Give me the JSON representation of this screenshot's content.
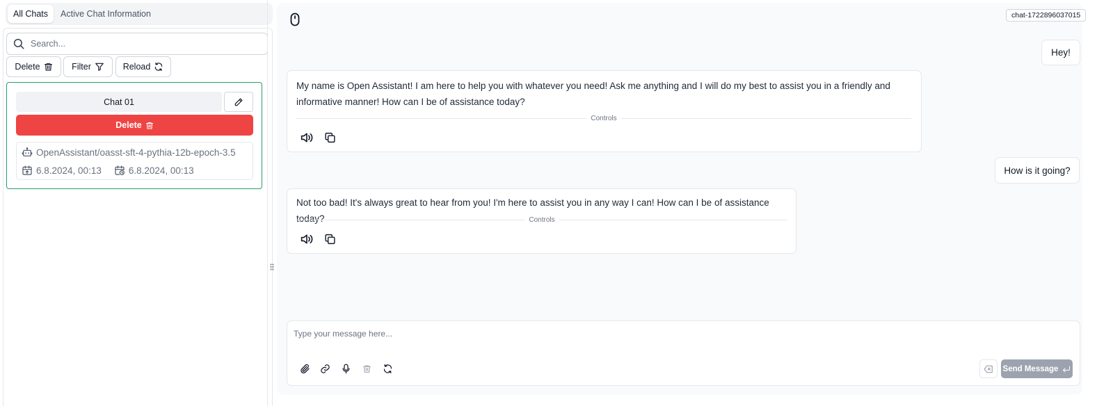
{
  "tabs": [
    {
      "label": "All Chats",
      "active": true
    },
    {
      "label": "Active Chat Information",
      "active": false
    }
  ],
  "search": {
    "placeholder": "Search..."
  },
  "toolbar": {
    "delete_label": "Delete",
    "filter_label": "Filter",
    "reload_label": "Reload"
  },
  "chat_list": [
    {
      "name": "Chat 01",
      "delete_label": "Delete",
      "model": "OpenAssistant/oasst-sft-4-pythia-12b-epoch-3.5",
      "created": "6.8.2024, 00:13",
      "updated": "6.8.2024, 00:13",
      "selected": true
    }
  ],
  "chat": {
    "id": "chat-1722896037015",
    "messages": [
      {
        "role": "user",
        "text": "Hey!"
      },
      {
        "role": "assistant",
        "lines": [
          "My name is Open Assistant! I am here to help you with whatever you need! Ask me anything and I will do my best to assist you in a friendly and",
          "informative manner! How can I be of assistance today?"
        ],
        "controls_label": "Controls"
      },
      {
        "role": "user",
        "text": "How is it going?"
      },
      {
        "role": "assistant",
        "lines": [
          "Not too bad! It's always great to hear from you! I'm here to assist you in any way I can! How can I be of assistance today?"
        ],
        "controls_label": "Controls"
      }
    ]
  },
  "composer": {
    "placeholder": "Type your message here...",
    "send_label": "Send Message",
    "icons": [
      "paperclip-icon",
      "link-icon",
      "microphone-icon",
      "trash-icon",
      "refresh-icon"
    ]
  },
  "colors": {
    "accent_green": "#22a06b",
    "danger": "#ef4444",
    "send_disabled": "#9ca3af",
    "panel_bg": "#f9fafb"
  }
}
